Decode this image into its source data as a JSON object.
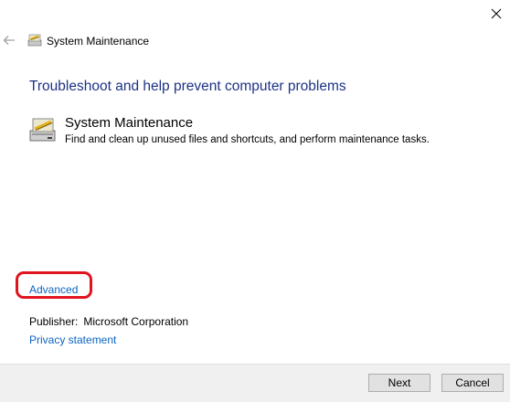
{
  "header": {
    "title": "System Maintenance"
  },
  "main": {
    "heading": "Troubleshoot and help prevent computer problems",
    "task": {
      "title": "System Maintenance",
      "description": "Find and clean up unused files and shortcuts, and perform maintenance tasks."
    },
    "advanced_link": "Advanced",
    "publisher_label": "Publisher:",
    "publisher_value": "Microsoft Corporation",
    "privacy_link": "Privacy statement"
  },
  "footer": {
    "next_label": "Next",
    "cancel_label": "Cancel"
  },
  "icons": {
    "close": "close-icon",
    "back": "back-arrow-icon",
    "task": "maintenance-icon"
  },
  "colors": {
    "heading": "#1e3287",
    "link": "#0b64c0",
    "highlight": "#e0141e"
  }
}
